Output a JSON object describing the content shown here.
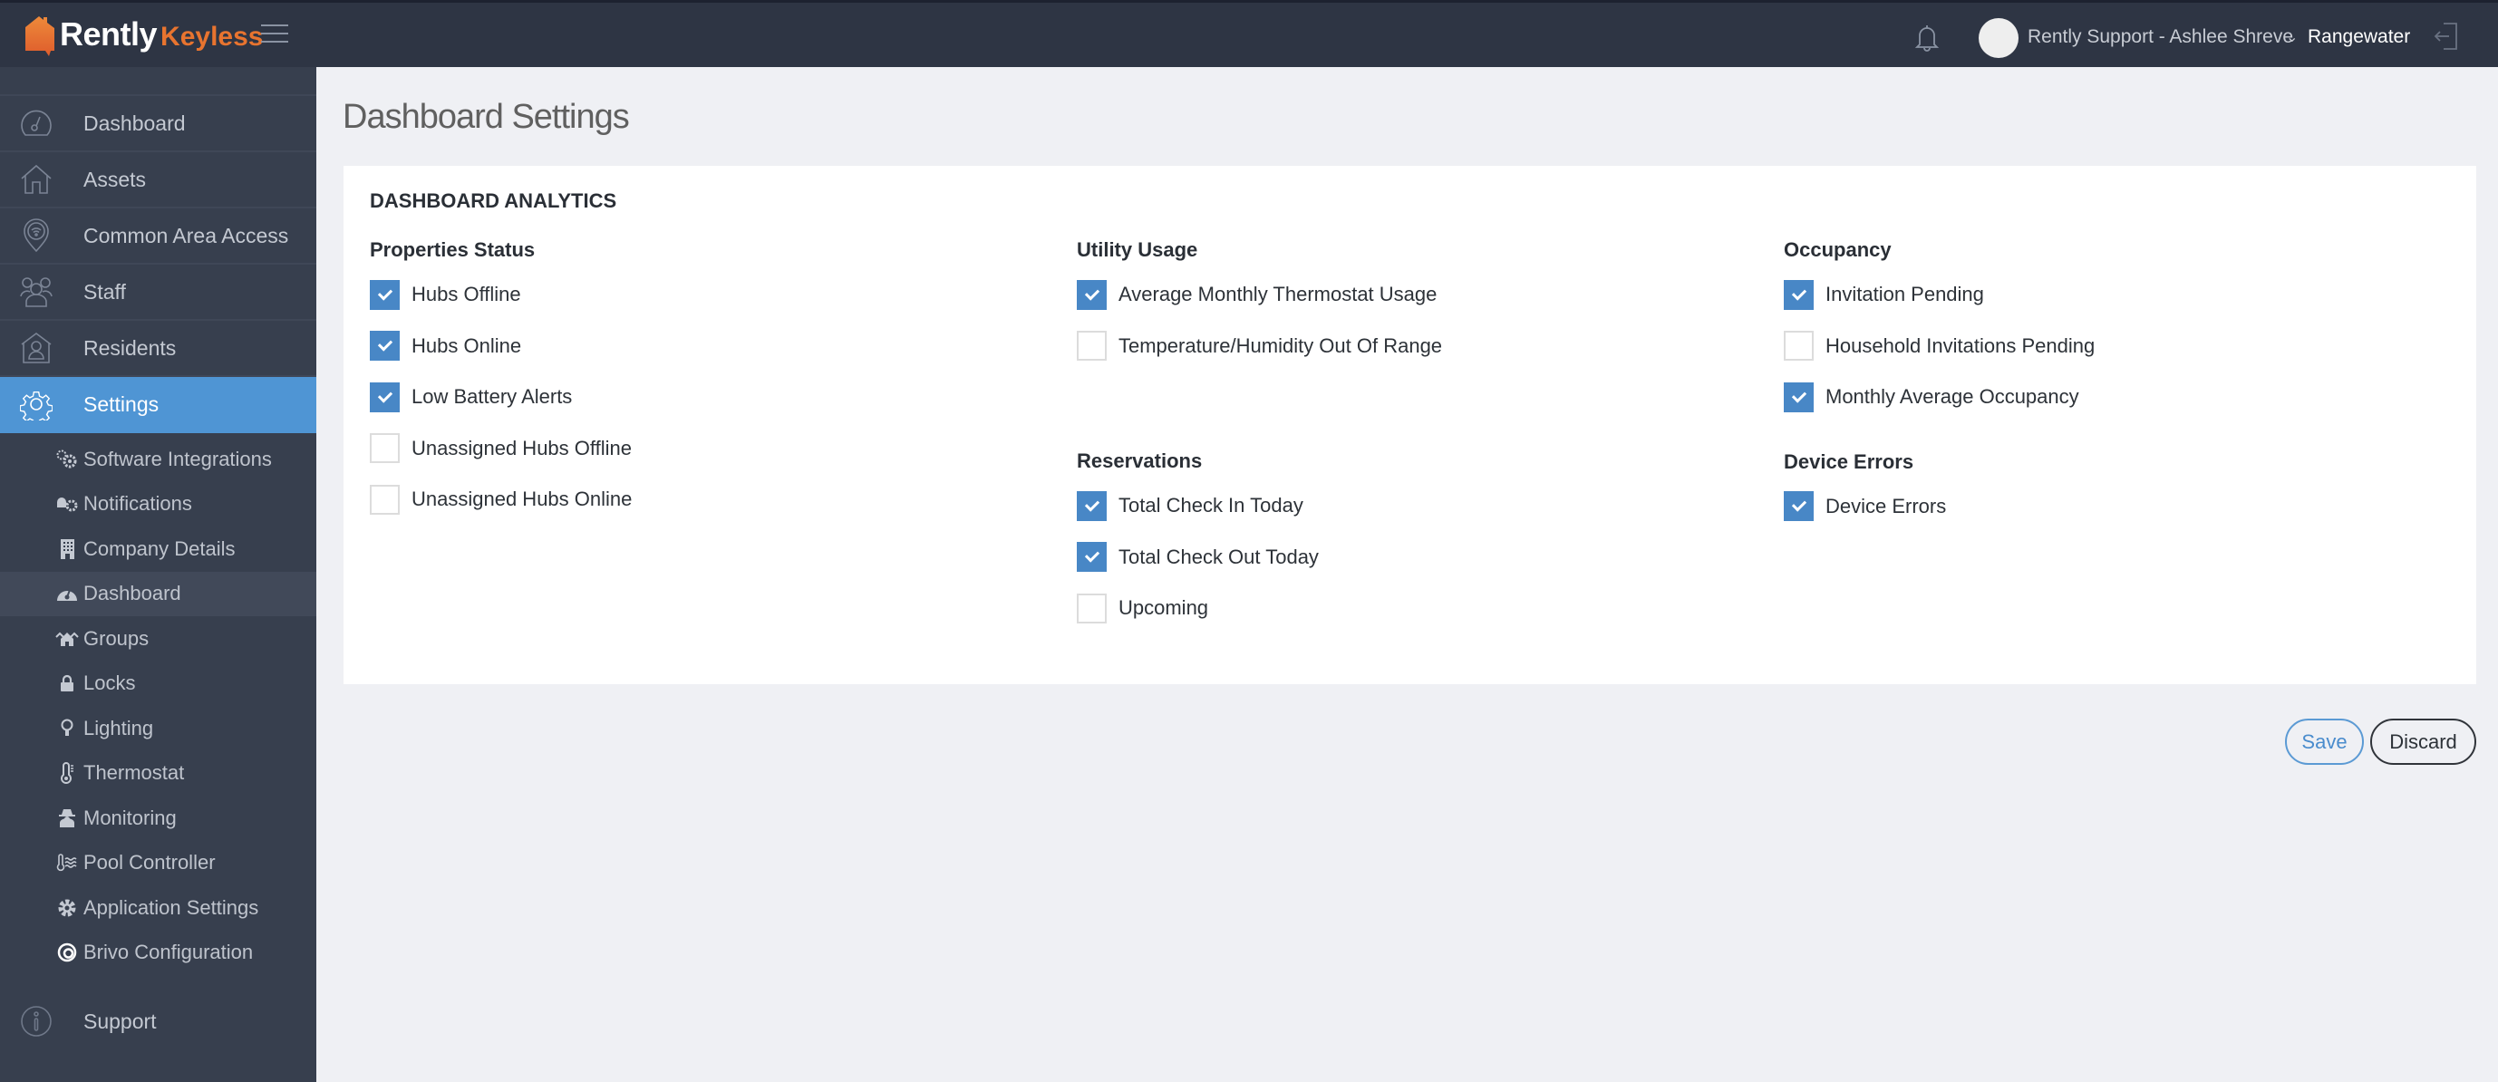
{
  "header": {
    "logo_primary": "Rently",
    "logo_secondary": "Keyless",
    "user_name": "Rently Support - Ashlee Shreve",
    "organization": "Rangewater",
    "icons": [
      "menu-icon",
      "bell-icon",
      "avatar",
      "chevron-down-icon",
      "logout-icon"
    ]
  },
  "sidebar": {
    "items": [
      {
        "label": "Dashboard",
        "icon": "speedometer-icon",
        "active": false
      },
      {
        "label": "Assets",
        "icon": "house-icon",
        "active": false
      },
      {
        "label": "Common Area Access",
        "icon": "location-wifi-icon",
        "active": false
      },
      {
        "label": "Staff",
        "icon": "users-icon",
        "active": false
      },
      {
        "label": "Residents",
        "icon": "resident-house-icon",
        "active": false
      },
      {
        "label": "Settings",
        "icon": "gear-icon",
        "active": true
      }
    ],
    "sub_items": [
      {
        "label": "Software Integrations",
        "icon": "gears-icon",
        "active": false
      },
      {
        "label": "Notifications",
        "icon": "bell-gear-icon",
        "active": false
      },
      {
        "label": "Company Details",
        "icon": "building-icon",
        "active": false
      },
      {
        "label": "Dashboard",
        "icon": "dashboard-gauge-icon",
        "active": true
      },
      {
        "label": "Groups",
        "icon": "houses-icon",
        "active": false
      },
      {
        "label": "Locks",
        "icon": "lock-icon",
        "active": false
      },
      {
        "label": "Lighting",
        "icon": "lightbulb-icon",
        "active": false
      },
      {
        "label": "Thermostat",
        "icon": "thermometer-icon",
        "active": false
      },
      {
        "label": "Monitoring",
        "icon": "spy-icon",
        "active": false
      },
      {
        "label": "Pool Controller",
        "icon": "pool-temperature-icon",
        "active": false
      },
      {
        "label": "Application Settings",
        "icon": "cog-icon",
        "active": false
      },
      {
        "label": "Brivo Configuration",
        "icon": "brivo-icon",
        "active": false
      }
    ],
    "support": {
      "label": "Support",
      "icon": "info-icon"
    }
  },
  "page": {
    "title": "Dashboard Settings",
    "card_title": "DASHBOARD ANALYTICS",
    "columns": [
      {
        "groups": [
          {
            "title": "Properties Status",
            "options": [
              {
                "label": "Hubs Offline",
                "checked": true
              },
              {
                "label": "Hubs Online",
                "checked": true
              },
              {
                "label": "Low Battery Alerts",
                "checked": true
              },
              {
                "label": "Unassigned Hubs Offline",
                "checked": false
              },
              {
                "label": "Unassigned Hubs Online",
                "checked": false
              }
            ]
          }
        ]
      },
      {
        "groups": [
          {
            "title": "Utility Usage",
            "options": [
              {
                "label": "Average Monthly Thermostat Usage",
                "checked": true
              },
              {
                "label": "Temperature/Humidity Out Of Range",
                "checked": false
              }
            ]
          },
          {
            "title": "Reservations",
            "options": [
              {
                "label": "Total Check In Today",
                "checked": true
              },
              {
                "label": "Total Check Out Today",
                "checked": true
              },
              {
                "label": "Upcoming",
                "checked": false
              }
            ]
          }
        ]
      },
      {
        "groups": [
          {
            "title": "Occupancy",
            "options": [
              {
                "label": "Invitation Pending",
                "checked": true
              },
              {
                "label": "Household Invitations Pending",
                "checked": false
              },
              {
                "label": "Monthly Average Occupancy",
                "checked": true
              }
            ]
          },
          {
            "title": "Device Errors",
            "options": [
              {
                "label": "Device Errors",
                "checked": true
              }
            ]
          }
        ]
      }
    ],
    "save_label": "Save",
    "discard_label": "Discard"
  },
  "colors": {
    "header_bg": "#2e3544",
    "sidebar_bg": "#373f4e",
    "accent": "#4f95d4",
    "checkbox_checked": "#4887c6",
    "brand_orange": "#e8742f",
    "page_bg": "#eff0f4"
  }
}
